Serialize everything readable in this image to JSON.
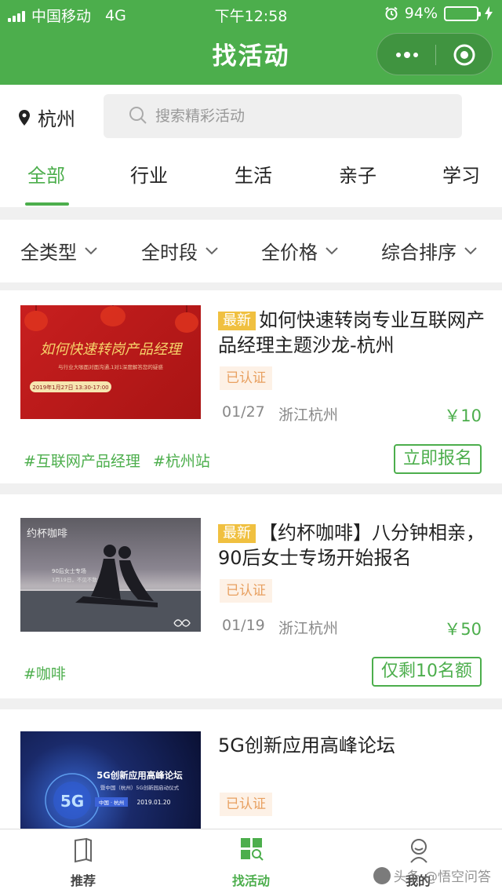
{
  "status_bar": {
    "carrier": "中国移动",
    "network": "4G",
    "time": "下午12:58",
    "battery": "94%",
    "battery_level": 0.94
  },
  "nav": {
    "title": "找活动"
  },
  "location": {
    "city": "杭州"
  },
  "search": {
    "placeholder": "搜索精彩活动"
  },
  "category_tabs": [
    "全部",
    "行业",
    "生活",
    "亲子",
    "学习"
  ],
  "filters": [
    "全类型",
    "全时段",
    "全价格",
    "综合排序"
  ],
  "events": [
    {
      "badge": "最新",
      "title": "如何快速转岗专业互联网产品经理主题沙龙-杭州",
      "verified": "已认证",
      "date": "01/27",
      "place": "浙江杭州",
      "price": "￥10",
      "tags": [
        "#互联网产品经理",
        "#杭州站"
      ],
      "action": "立即报名",
      "image": {
        "headline": "如何快速转岗产品经理",
        "subline": "与行业大咖面对面沟通,1对1深度解答您的疑惑",
        "date": "2019年1月27日 13:30-17:00"
      }
    },
    {
      "badge": "最新",
      "title": "【约杯咖啡】八分钟相亲，90后女士专场开始报名",
      "verified": "已认证",
      "date": "01/19",
      "place": "浙江杭州",
      "price": "￥50",
      "tags": [
        "#咖啡"
      ],
      "action": "仅剩10名额",
      "image": {
        "logo": "约杯咖啡",
        "subline": "90后女士专场",
        "date": "1月19日，不见不散"
      }
    },
    {
      "badge": "",
      "title": "5G创新应用高峰论坛",
      "verified": "已认证",
      "image": {
        "headline": "5G创新应用高峰论坛",
        "subline": "暨中国（杭州）5G创新园启动仪式",
        "city": "中国 · 杭州",
        "date": "2019.01.20",
        "mark": "5G"
      }
    }
  ],
  "tabbar": [
    "推荐",
    "找活动",
    "我的"
  ],
  "watermark": "头条 @悟空问答",
  "colors": {
    "primary": "#4cae4c",
    "badge": "#f0c040",
    "verified_text": "#e8a060",
    "verified_bg": "#fdf1e6"
  }
}
